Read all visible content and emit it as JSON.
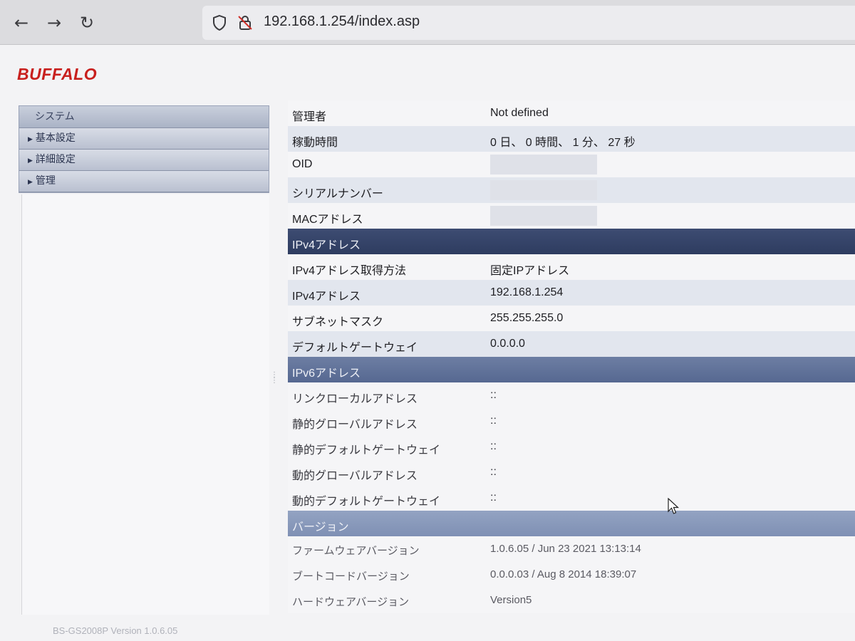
{
  "browser": {
    "back_icon": "back-arrow-icon",
    "forward_icon": "forward-arrow-icon",
    "reload_icon": "reload-icon",
    "url": "192.168.1.254/index.asp"
  },
  "logo": "BUFFALO",
  "sidebar": {
    "header": "システム",
    "items": [
      {
        "label": "基本設定"
      },
      {
        "label": "詳細設定"
      },
      {
        "label": "管理"
      }
    ]
  },
  "status": {
    "rows": [
      {
        "label": "管理者",
        "value": "Not defined"
      },
      {
        "label": "稼動時間",
        "value": "0 日、 0 時間、 1 分、 27 秒"
      },
      {
        "label": "OID",
        "value": ""
      },
      {
        "label": "シリアルナンバー",
        "value": ""
      },
      {
        "label": "MACアドレス",
        "value": ""
      }
    ],
    "ipv4_header": "IPv4アドレス",
    "ipv4_rows": [
      {
        "label": "IPv4アドレス取得方法",
        "value": "固定IPアドレス"
      },
      {
        "label": "IPv4アドレス",
        "value": "192.168.1.254"
      },
      {
        "label": "サブネットマスク",
        "value": "255.255.255.0"
      },
      {
        "label": "デフォルトゲートウェイ",
        "value": "0.0.0.0"
      }
    ],
    "ipv6_header": "IPv6アドレス",
    "ipv6_rows": [
      {
        "label": "リンクローカルアドレス",
        "value": "::"
      },
      {
        "label": "静的グローバルアドレス",
        "value": "::"
      },
      {
        "label": "静的デフォルトゲートウェイ",
        "value": "::"
      },
      {
        "label": "動的グローバルアドレス",
        "value": "::"
      },
      {
        "label": "動的デフォルトゲートウェイ",
        "value": "::"
      }
    ],
    "version_header": "バージョン",
    "version_rows": [
      {
        "label": "ファームウェアバージョン",
        "value": "1.0.6.05 / Jun 23 2021 13:13:14"
      },
      {
        "label": "ブートコードバージョン",
        "value": "0.0.0.03 / Aug 8 2014 18:39:07"
      },
      {
        "label": "ハードウェアバージョン",
        "value": "Version5"
      }
    ]
  },
  "footer": "BS-GS2008P Version 1.0.6.05",
  "colors": {
    "logo": "#c8201e",
    "section_header": "#2e3c60",
    "row_alt": "#e2e6ee"
  }
}
